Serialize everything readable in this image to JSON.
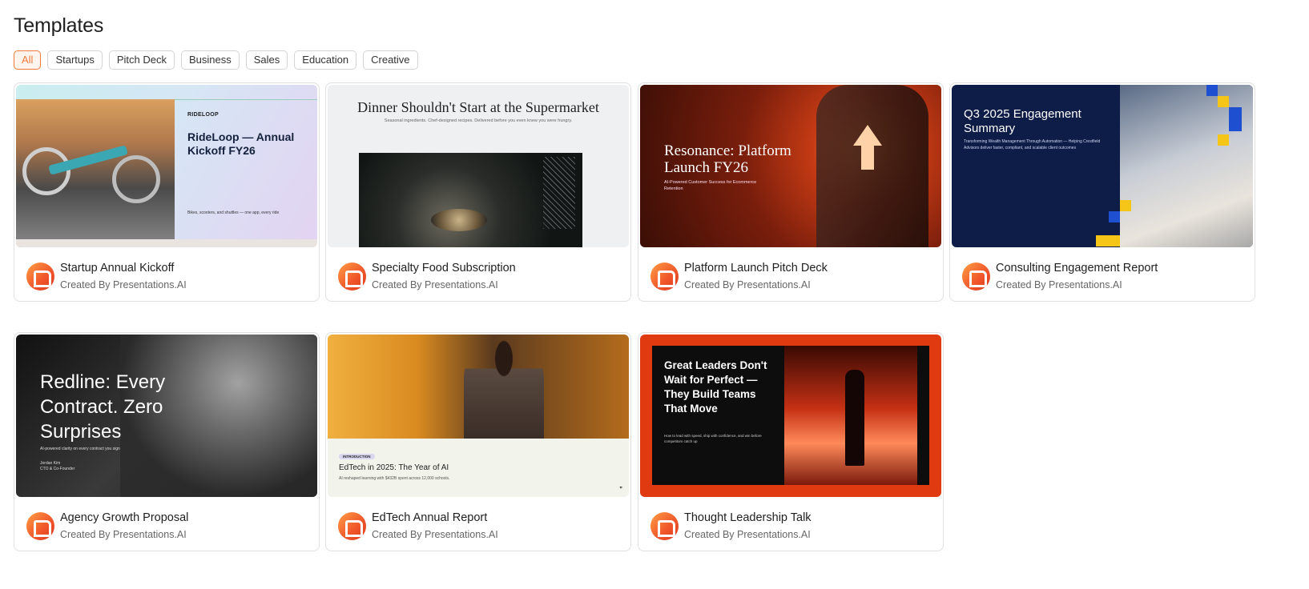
{
  "page": {
    "title": "Templates"
  },
  "filters": [
    {
      "label": "All",
      "active": true
    },
    {
      "label": "Startups",
      "active": false
    },
    {
      "label": "Pitch Deck",
      "active": false
    },
    {
      "label": "Business",
      "active": false
    },
    {
      "label": "Sales",
      "active": false
    },
    {
      "label": "Education",
      "active": false
    },
    {
      "label": "Creative",
      "active": false
    }
  ],
  "cards": [
    {
      "title": "Startup Annual Kickoff",
      "creator": "Created By Presentations.AI",
      "thumb": {
        "brand": "RIDELOOP",
        "heading": "RideLoop — Annual Kickoff FY26",
        "footer": "Bikes, scooters, and shuttles — one app, every ride"
      }
    },
    {
      "title": "Specialty Food Subscription",
      "creator": "Created By Presentations.AI",
      "thumb": {
        "heading": "Dinner Shouldn't Start at the Supermarket",
        "subheading": "Seasonal ingredients. Chef-designed recipes. Delivered before you even knew you were hungry."
      }
    },
    {
      "title": "Platform Launch Pitch Deck",
      "creator": "Created By Presentations.AI",
      "thumb": {
        "heading": "Resonance: Platform Launch FY26",
        "subheading": "AI-Powered Customer Success for Ecommerce Retention"
      }
    },
    {
      "title": "Consulting Engagement Report",
      "creator": "Created By Presentations.AI",
      "thumb": {
        "heading": "Q3 2025 Engagement Summary",
        "subheading": "Transforming Wealth Management Through Automation — Helping Crestfield Advisors deliver faster, compliant, and scalable client outcomes"
      }
    },
    {
      "title": "Agency Growth Proposal",
      "creator": "Created By Presentations.AI",
      "thumb": {
        "heading": "Redline: Every Contract. Zero Surprises",
        "subheading": "AI-powered clarity on every contract you sign",
        "person": "Jordan Kim",
        "role": "CTO & Co-Founder"
      }
    },
    {
      "title": "EdTech Annual Report",
      "creator": "Created By Presentations.AI",
      "thumb": {
        "pill": "INTRODUCTION",
        "heading": "EdTech in 2025: The Year of AI",
        "subheading": "AI reshaped learning with $432B spent across 12,000 schools."
      }
    },
    {
      "title": "Thought Leadership Talk",
      "creator": "Created By Presentations.AI",
      "thumb": {
        "heading": "Great Leaders Don't Wait for Perfect — They Build Teams That Move",
        "subheading": "How to lead with speed, ship with confidence, and win before competitors catch up"
      }
    }
  ],
  "colors": {
    "accent": "#f07a3c",
    "logo_start": "#ff9f45",
    "logo_end": "#d93a1e"
  },
  "icons": {
    "creator_logo": "presentations-ai-logo-icon"
  }
}
